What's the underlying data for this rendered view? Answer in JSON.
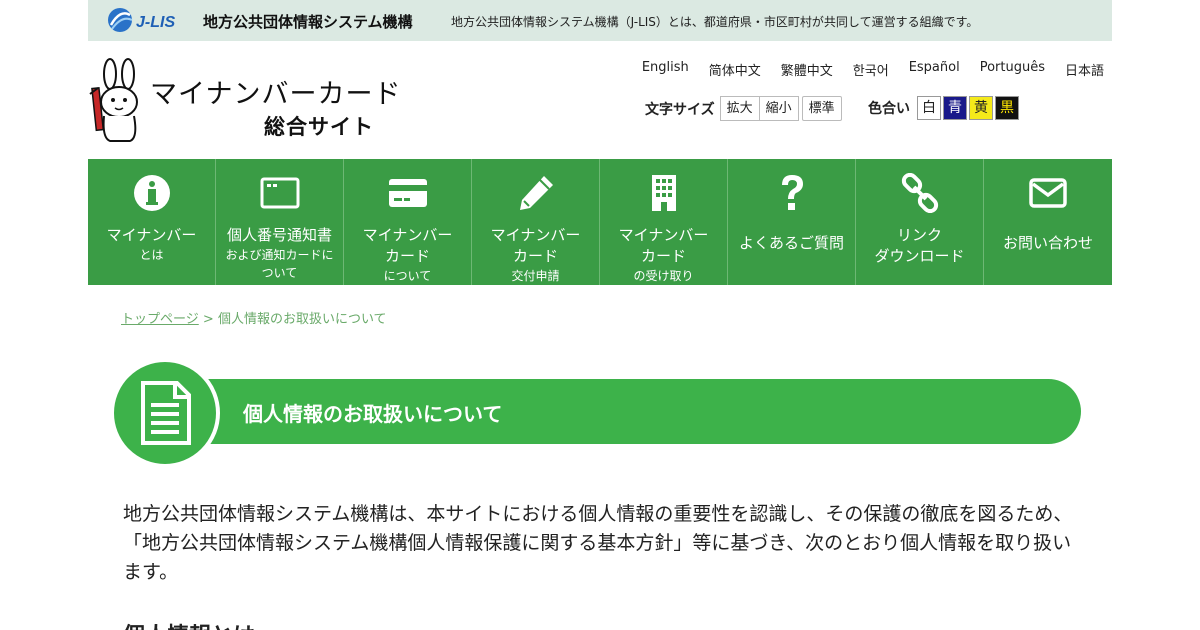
{
  "org_bar": {
    "logo_text": "J-LIS",
    "name": "地方公共団体情報システム機構",
    "separator": "：",
    "description": "地方公共団体情報システム機構（J-LIS）とは、都道府県・市区町村が共同して運営する組織です。"
  },
  "site": {
    "title_line1": "マイナンバーカード",
    "title_line2": "総合サイト"
  },
  "languages": [
    "English",
    "简体中文",
    "繁體中文",
    "한국어",
    "Español",
    "Português",
    "日本語"
  ],
  "font_size": {
    "label": "文字サイズ",
    "enlarge": "拡大",
    "shrink": "縮小",
    "standard": "標準"
  },
  "color_scheme": {
    "label": "色合い",
    "white": "白",
    "blue": "青",
    "yellow": "黄",
    "black": "黒"
  },
  "nav": {
    "items": [
      {
        "icon": "info-icon",
        "line1": "マイナンバー",
        "line2": "とは"
      },
      {
        "icon": "card-outline-icon",
        "line1": "個人番号通知書",
        "line2": "および通知カードについて"
      },
      {
        "icon": "credit-card-icon",
        "line1": "マイナンバー",
        "line1b": "カード",
        "line2": "について"
      },
      {
        "icon": "pencil-icon",
        "line1": "マイナンバー",
        "line1b": "カード",
        "line2": "交付申請"
      },
      {
        "icon": "building-icon",
        "line1": "マイナンバー",
        "line1b": "カード",
        "line2": "の受け取り"
      },
      {
        "icon": "question-icon",
        "line1": "よくあるご質問"
      },
      {
        "icon": "link-icon",
        "line1": "リンク",
        "line1b": "ダウンロード"
      },
      {
        "icon": "envelope-icon",
        "line1": "お問い合わせ"
      }
    ]
  },
  "breadcrumb": {
    "home": "トップページ",
    "separator": ">",
    "current": "個人情報のお取扱いについて"
  },
  "page_title": "個人情報のお取扱いについて",
  "intro_text": "地方公共団体情報システム機構は、本サイトにおける個人情報の重要性を認識し、その保護の徹底を図るため、「地方公共団体情報システム機構個人情報保護に関する基本方針」等に基づき、次のとおり個人情報を取り扱います。",
  "section_heading": "個人情報とは",
  "colors": {
    "nav_green": "#3a9c45",
    "heading_green": "#3db24a",
    "orgbar_bg": "#dbe9e2"
  }
}
